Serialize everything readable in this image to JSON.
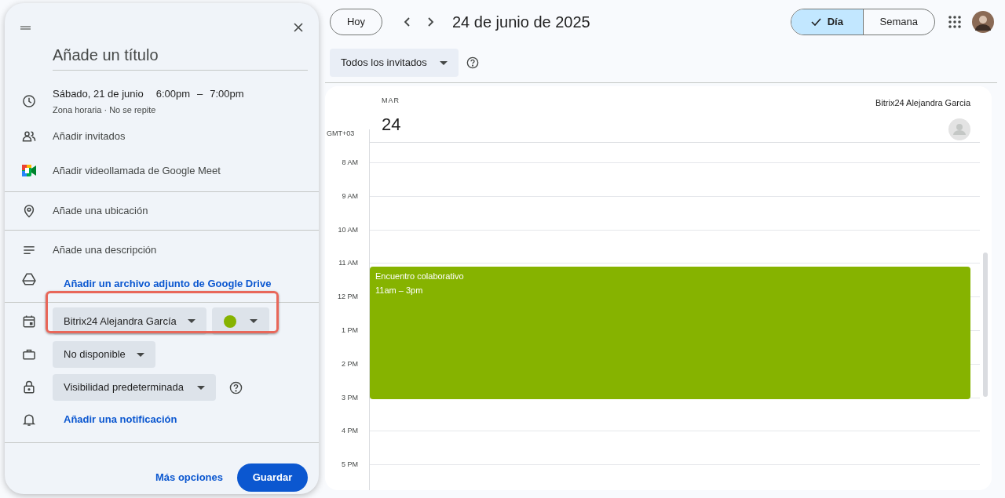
{
  "panel": {
    "title_placeholder": "Añade un título",
    "datetime": {
      "date": "Sábado, 21 de junio",
      "start": "6:00pm",
      "separator": "–",
      "end": "7:00pm",
      "details": "Zona horaria · No se repite"
    },
    "guests": "Añadir invitados",
    "meet": "Añadir videollamada de Google Meet",
    "location": "Añade una ubicación",
    "description": "Añade una descripción",
    "attachment": "Añadir un archivo adjunto de Google Drive",
    "calendar": {
      "name": "Bitrix24 Alejandra García",
      "color": "#86b300",
      "highlighted": true
    },
    "availability": "No disponible",
    "visibility": "Visibilidad predeterminada",
    "notification": "Añadir una notificación",
    "more_options": "Más opciones",
    "save": "Guardar"
  },
  "toolbar": {
    "today": "Hoy",
    "date_title": "24 de junio de 2025",
    "views": [
      {
        "label": "Día",
        "selected": true
      },
      {
        "label": "Semana",
        "selected": false
      }
    ]
  },
  "filter": {
    "value": "Todos los invitados"
  },
  "day": {
    "weekday": "MAR",
    "date": "24",
    "timezone": "GMT+03",
    "person": "Bitrix24 Alejandra Garcia"
  },
  "hours": [
    "8 AM",
    "9 AM",
    "10 AM",
    "11 AM",
    "12 PM",
    "1 PM",
    "2 PM",
    "3 PM",
    "4 PM",
    "5 PM"
  ],
  "event": {
    "title": "Encuentro colaborativo",
    "time": "11am – 3pm",
    "color": "#86b300"
  }
}
